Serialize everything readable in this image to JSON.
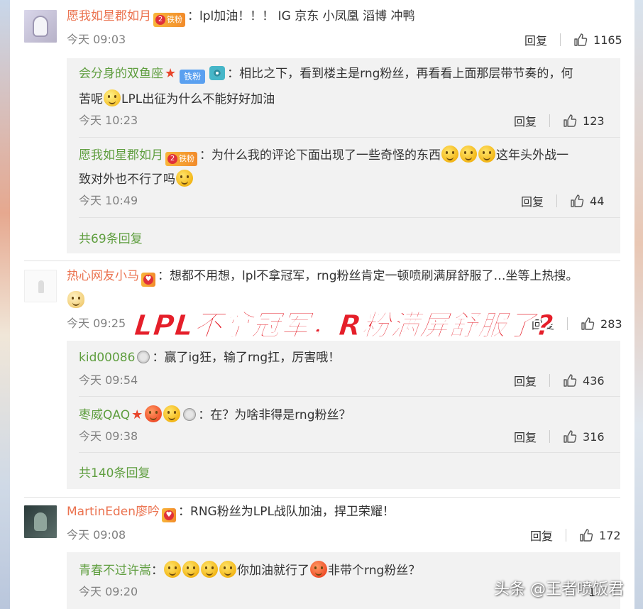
{
  "comments": [
    {
      "user": "愿我如星郡如月",
      "badge": "铁粉",
      "badge_level": "2",
      "text": "：lpl加油！！！ IG 京东 小凤凰 滔博 冲鸭",
      "time": "今天 09:03",
      "reply_label": "回复",
      "likes": "1165",
      "replies": [
        {
          "user": "会分身的双鱼座",
          "badge": "铁粉",
          "text_line1": "：相比之下，看到楼主是rng粉丝，再看看上面那层带节奏的，何",
          "text_line2a": "苦呢",
          "text_line2b": "LPL出征为什么不能好好加油",
          "time": "今天 10:23",
          "reply_label": "回复",
          "likes": "123"
        },
        {
          "user": "愿我如星郡如月",
          "badge": "铁粉",
          "badge_level": "2",
          "text_line1a": "：为什么我的评论下面出现了一些奇怪的东西",
          "text_line1b": "这年头外战一",
          "text_line2": "致对外也不行了吗",
          "time": "今天 10:49",
          "reply_label": "回复",
          "likes": "44"
        }
      ],
      "more_replies": "共69条回复"
    },
    {
      "user": "热心网友小马",
      "text": "：想都不用想，lpl不拿冠军，rng粉丝肯定一顿喷刷满屏舒服了…坐等上热搜。",
      "time": "今天 09:25",
      "reply_label": "回复",
      "likes": "283",
      "replies": [
        {
          "user": "kid00086",
          "text": "：赢了ig狂，输了rng扛，厉害哦！",
          "time": "今天 09:54",
          "reply_label": "回复",
          "likes": "436"
        },
        {
          "user": "枣威QAQ",
          "text": "：在？为啥非得是rng粉丝？",
          "time": "今天 09:38",
          "reply_label": "回复",
          "likes": "316"
        }
      ],
      "more_replies": "共140条回复"
    },
    {
      "user": "MartinEden廖吟",
      "text": "：RNG粉丝为LPL战队加油，捍卫荣耀！",
      "time": "今天 09:08",
      "reply_label": "回复",
      "likes": "172",
      "replies": [
        {
          "user": "青春不过许嵩",
          "text_a": "：",
          "text_b": "你加油就行了",
          "text_c": "非带个rng粉丝？",
          "time": "今天 09:20",
          "likes": "1"
        }
      ]
    }
  ],
  "overlay_caption": "LPL不拿冠军，R粉满屏舒服了?",
  "watermark": "头条 @王者喷饭君",
  "colors": {
    "username_main": "#eb7350",
    "username_reply": "#5f9e3f",
    "caption": "#e51f2a"
  }
}
